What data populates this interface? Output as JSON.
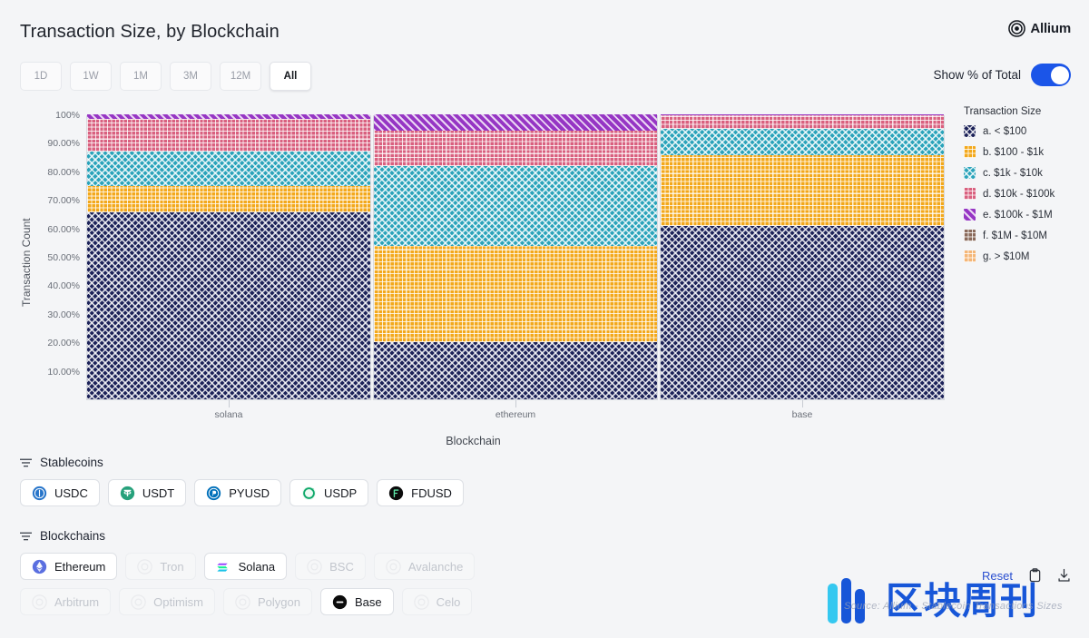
{
  "header": {
    "title": "Transaction Size, by Blockchain",
    "brand": "Allium",
    "brand_icon": "allium-target-logo"
  },
  "range_tabs": [
    {
      "label": "1D",
      "active": false
    },
    {
      "label": "1W",
      "active": false
    },
    {
      "label": "1M",
      "active": false
    },
    {
      "label": "3M",
      "active": false
    },
    {
      "label": "12M",
      "active": false
    },
    {
      "label": "All",
      "active": true
    }
  ],
  "toggle": {
    "label": "Show % of Total",
    "on": true,
    "accent": "#1b55e8"
  },
  "legend": {
    "title": "Transaction Size",
    "items": [
      {
        "label": "a. < $100",
        "color": "#1c2259",
        "pattern": "crosshatch"
      },
      {
        "label": "b. $100 - $1k",
        "color": "#f3a81b",
        "pattern": "dots"
      },
      {
        "label": "c. $1k - $10k",
        "color": "#2aa3ba",
        "pattern": "crosshatch"
      },
      {
        "label": "d. $10k - $100k",
        "color": "#d9607f",
        "pattern": "dots"
      },
      {
        "label": "e. $100k - $1M",
        "color": "#9636c4",
        "pattern": "diagonal"
      },
      {
        "label": "f. $1M - $10M",
        "color": "#8a6a5b",
        "pattern": "dots"
      },
      {
        "label": "g. > $10M",
        "color": "#f4b677",
        "pattern": "dots"
      }
    ]
  },
  "chart_data": {
    "type": "bar",
    "title": "Transaction Size, by Blockchain",
    "xlabel": "Blockchain",
    "ylabel": "Transaction Count",
    "stacked": true,
    "normalized_percent": true,
    "ylim": [
      0,
      100
    ],
    "ytick_labels": [
      "100%",
      "90.00%",
      "80.00%",
      "70.00%",
      "60.00%",
      "50.00%",
      "40.00%",
      "30.00%",
      "20.00%",
      "10.00%"
    ],
    "ytick_values": [
      100,
      90,
      80,
      70,
      60,
      50,
      40,
      30,
      20,
      10
    ],
    "grid": false,
    "legend_position": "right",
    "categories": [
      "solana",
      "ethereum",
      "base"
    ],
    "series": [
      {
        "name": "a. < $100",
        "color": "#1c2259",
        "pattern": "crosshatch",
        "values": [
          65.5,
          20.0,
          60.8
        ]
      },
      {
        "name": "b. $100 - $1k",
        "color": "#f3a81b",
        "pattern": "dots",
        "values": [
          9.5,
          33.8,
          24.8
        ]
      },
      {
        "name": "c. $1k - $10k",
        "color": "#2aa3ba",
        "pattern": "crosshatch",
        "values": [
          11.8,
          28.0,
          9.2
        ]
      },
      {
        "name": "d. $10k - $100k",
        "color": "#d9607f",
        "pattern": "dots",
        "values": [
          11.5,
          12.4,
          5.1
        ]
      },
      {
        "name": "e. $100k - $1M",
        "color": "#9636c4",
        "pattern": "diagonal",
        "values": [
          1.7,
          5.8,
          0.1
        ]
      }
    ]
  },
  "stablecoins": {
    "title": "Stablecoins",
    "filter_icon": "filter-icon",
    "chips": [
      {
        "label": "USDC",
        "icon": "usdc-icon",
        "icon_color": "#2775ca",
        "active": true
      },
      {
        "label": "USDT",
        "icon": "usdt-icon",
        "icon_color": "#26a17b",
        "active": true
      },
      {
        "label": "PYUSD",
        "icon": "pyusd-icon",
        "icon_color": "#0070ba",
        "active": true
      },
      {
        "label": "USDP",
        "icon": "usdp-icon",
        "icon_color": "#0fa86a",
        "active": true
      },
      {
        "label": "FDUSD",
        "icon": "fdusd-icon",
        "icon_color": "#0b0b0b",
        "active": true
      }
    ]
  },
  "blockchains": {
    "title": "Blockchains",
    "filter_icon": "filter-icon",
    "rows": [
      [
        {
          "label": "Ethereum",
          "icon": "ethereum-icon",
          "icon_color": "#5a6fe0",
          "active": true
        },
        {
          "label": "Tron",
          "icon": "tron-icon",
          "icon_color": "#c9ccd2",
          "active": false
        },
        {
          "label": "Solana",
          "icon": "solana-icon",
          "icon_color": "#14f195",
          "active": true
        },
        {
          "label": "BSC",
          "icon": "bsc-icon",
          "icon_color": "#c9ccd2",
          "active": false
        },
        {
          "label": "Avalanche",
          "icon": "avalanche-icon",
          "icon_color": "#c9ccd2",
          "active": false
        }
      ],
      [
        {
          "label": "Arbitrum",
          "icon": "arbitrum-icon",
          "icon_color": "#c9ccd2",
          "active": false
        },
        {
          "label": "Optimism",
          "icon": "optimism-icon",
          "icon_color": "#c9ccd2",
          "active": false
        },
        {
          "label": "Polygon",
          "icon": "polygon-icon",
          "icon_color": "#c9ccd2",
          "active": false
        },
        {
          "label": "Base",
          "icon": "base-icon",
          "icon_color": "#0b0b0b",
          "active": true
        },
        {
          "label": "Celo",
          "icon": "celo-icon",
          "icon_color": "#c9ccd2",
          "active": false
        }
      ]
    ]
  },
  "footer": {
    "reset_label": "Reset",
    "copy_icon": "clipboard-icon",
    "download_icon": "download-icon"
  },
  "watermark": {
    "text": "区块周刊",
    "subtext": "Source: Allium - Stablecoin Transactions Sizes",
    "color": "#1756d8"
  }
}
